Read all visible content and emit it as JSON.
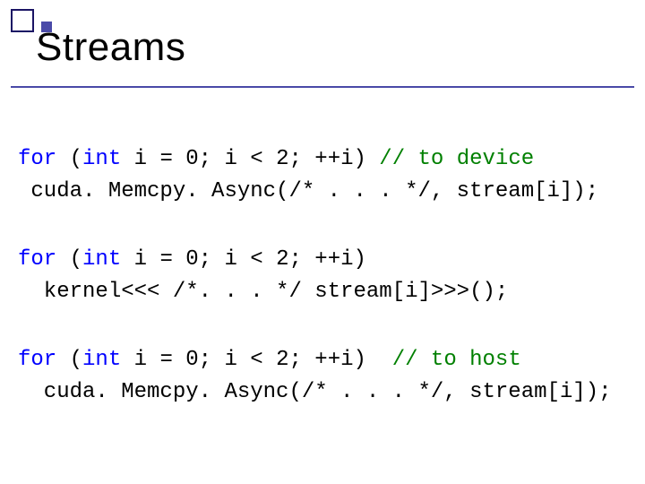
{
  "title": "Streams",
  "code": {
    "b1": {
      "l1a": "for",
      "l1b": " (",
      "l1c": "int",
      "l1d": " i = 0; i < 2; ++i) ",
      "l1e": "// to device",
      "l2": " cuda. Memcpy. Async(/* . . . */, stream[i]);"
    },
    "b2": {
      "l1a": "for",
      "l1b": " (",
      "l1c": "int",
      "l1d": " i = 0; i < 2; ++i)",
      "l2": "  kernel<<< /*. . . */ stream[i]>>>();"
    },
    "b3": {
      "l1a": "for",
      "l1b": " (",
      "l1c": "int",
      "l1d": " i = 0; i < 2; ++i)  ",
      "l1e": "// to host",
      "l2": "  cuda. Memcpy. Async(/* . . . */, stream[i]);"
    }
  }
}
